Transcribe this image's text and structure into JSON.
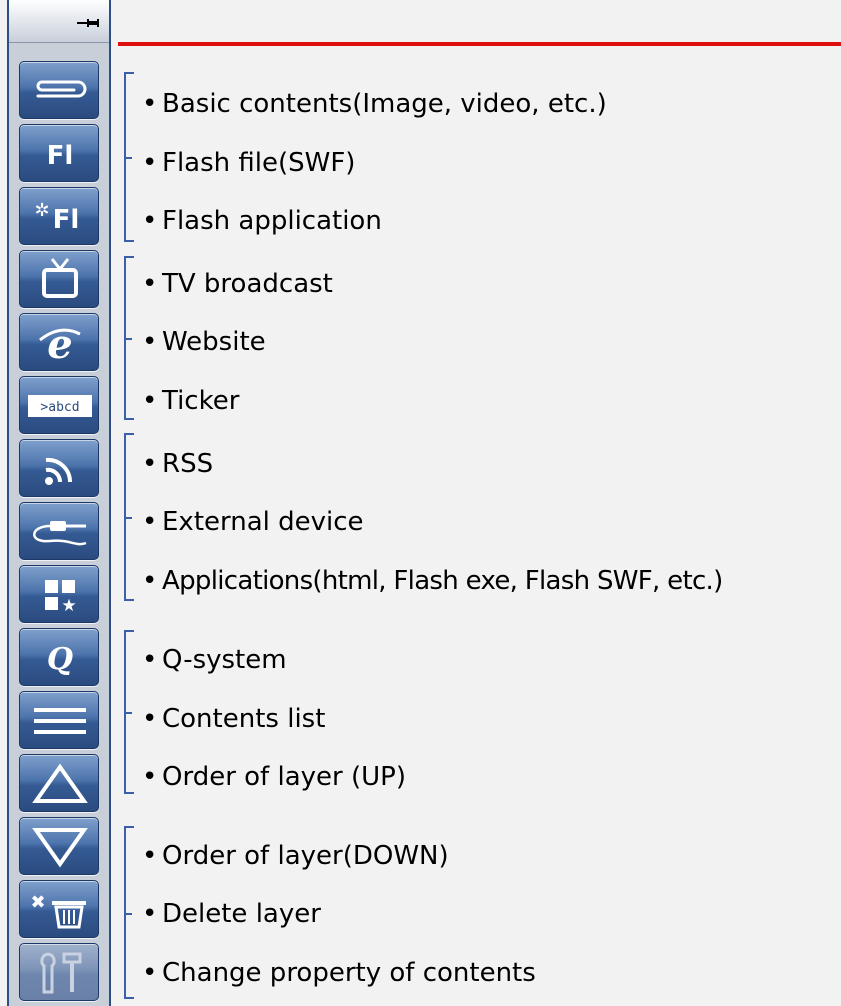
{
  "toolbar": {
    "pin_icon": "pin-icon",
    "buttons": [
      {
        "name": "basic-contents-button",
        "icon": "paperclip-icon"
      },
      {
        "name": "flash-file-button",
        "icon": "flash-icon",
        "label": "Fl"
      },
      {
        "name": "flash-application-button",
        "icon": "flash-app-icon",
        "label": "Fl"
      },
      {
        "name": "tv-broadcast-button",
        "icon": "tv-icon"
      },
      {
        "name": "website-button",
        "icon": "internet-explorer-icon"
      },
      {
        "name": "ticker-button",
        "icon": "ticker-icon",
        "label": ">abcd"
      },
      {
        "name": "rss-button",
        "icon": "rss-icon"
      },
      {
        "name": "external-device-button",
        "icon": "cable-icon"
      },
      {
        "name": "applications-button",
        "icon": "apps-grid-icon"
      },
      {
        "name": "q-system-button",
        "icon": "q-system-icon",
        "label": "Q"
      },
      {
        "name": "contents-list-button",
        "icon": "list-icon"
      },
      {
        "name": "layer-up-button",
        "icon": "triangle-up-icon"
      },
      {
        "name": "layer-down-button",
        "icon": "triangle-down-icon"
      },
      {
        "name": "delete-layer-button",
        "icon": "trash-icon"
      },
      {
        "name": "change-property-button",
        "icon": "tools-icon"
      }
    ]
  },
  "colors": {
    "accent_line": "#e01010",
    "bracket": "#3b5fa8",
    "button": "#355a93"
  },
  "descriptions": [
    "Basic contents(Image, video, etc.)",
    "Flash file(SWF)",
    "Flash application",
    "TV broadcast",
    "Website",
    "Ticker",
    "RSS",
    "External device",
    "Applications(html, Flash exe, Flash SWF, etc.)",
    "Q-system",
    "Contents list",
    "Order of layer (UP)",
    "Order of layer(DOWN)",
    "Delete layer",
    "Change property of contents"
  ]
}
